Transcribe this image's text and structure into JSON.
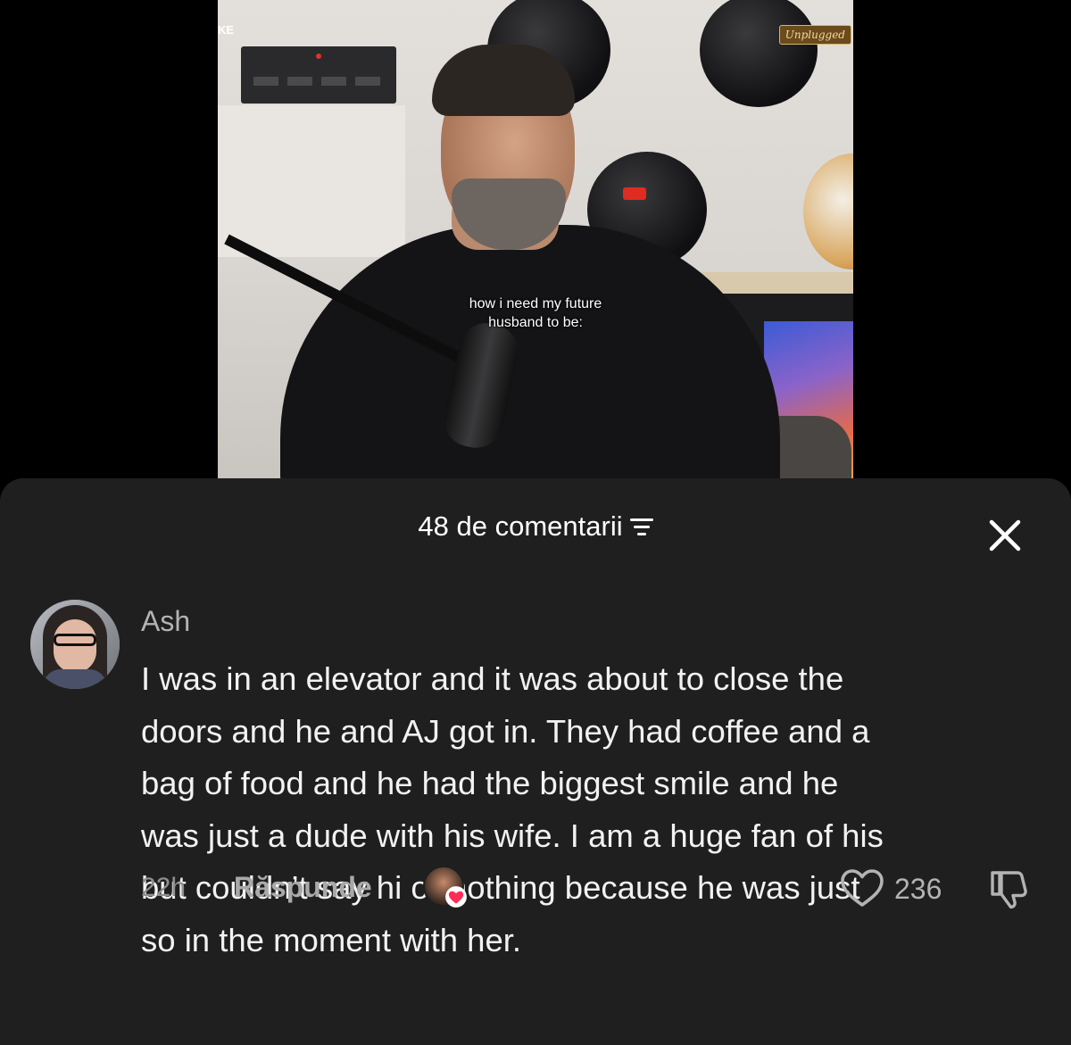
{
  "video": {
    "corner_text": "KE",
    "logo_badge": "Unplugged",
    "caption_lines": [
      "how i need my future",
      "husband to be:"
    ]
  },
  "comments_panel": {
    "title": "48 de comentarii",
    "sort_icon": "sort-filter-icon",
    "close_icon": "close-icon"
  },
  "comment": {
    "username": "Ash",
    "text_lines": [
      "I was in an elevator and it was about to close the",
      "doors and he and AJ got in. They had coffee and a",
      "bag of food and he had the biggest smile and he",
      "was just a dude with his wife. I am a huge fan of his",
      "but couldn’t say hi or nothing because he was just",
      "so in the moment with her."
    ],
    "time": "22h",
    "reply_label": "Răspunde",
    "like_count": "236",
    "like_icon": "heart-outline-icon",
    "dislike_icon": "thumbs-down-icon",
    "creator_liked_icon": "creator-heart-icon"
  },
  "colors": {
    "sheet_bg": "#1f1f1f",
    "heart_red": "#ff2d55",
    "muted_text": "#b3b3b3"
  }
}
